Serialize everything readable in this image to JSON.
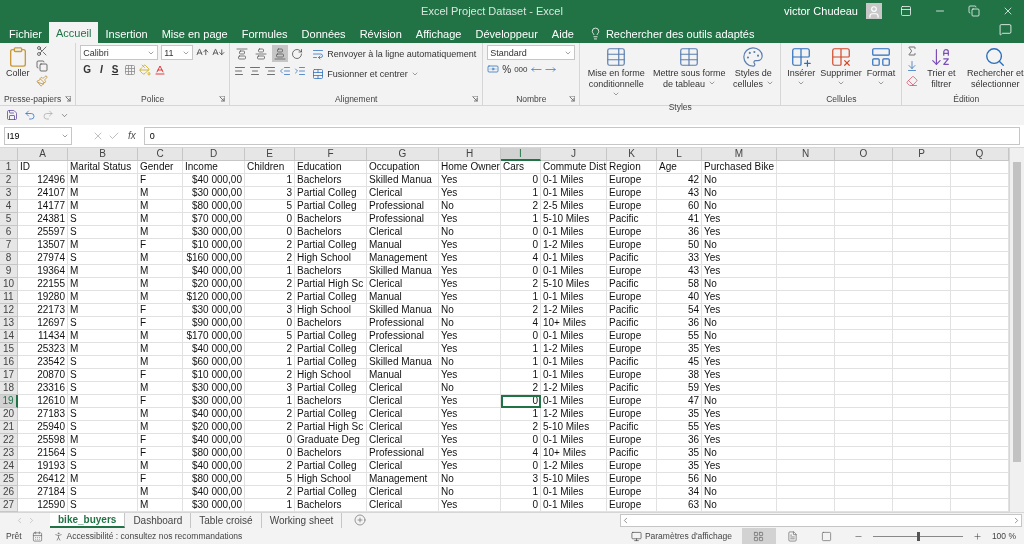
{
  "title_bar": {
    "title": "Excel Project Dataset  -  Excel",
    "user": "victor Chudeau"
  },
  "menu_tabs": [
    {
      "label": "Fichier",
      "selected": false
    },
    {
      "label": "Accueil",
      "selected": true
    },
    {
      "label": "Insertion",
      "selected": false
    },
    {
      "label": "Mise en page",
      "selected": false
    },
    {
      "label": "Formules",
      "selected": false
    },
    {
      "label": "Données",
      "selected": false
    },
    {
      "label": "Révision",
      "selected": false
    },
    {
      "label": "Affichage",
      "selected": false
    },
    {
      "label": "Développeur",
      "selected": false
    },
    {
      "label": "Aide",
      "selected": false
    }
  ],
  "tell_me": "Rechercher des outils adaptés",
  "ribbon": {
    "clipboard": {
      "label": "Presse-papiers",
      "paste": "Coller"
    },
    "font": {
      "label": "Police",
      "font_name": "Calibri",
      "font_size": "11",
      "styles": [
        "G",
        "I",
        "S"
      ]
    },
    "alignment": {
      "label": "Alignement",
      "vertical_alignment": [
        {
          "selected": false
        },
        {
          "selected": false
        },
        {
          "selected": true
        }
      ],
      "wrap": "Renvoyer à la ligne automatiquement",
      "merge": "Fusionner et centrer"
    },
    "number": {
      "label": "Nombre",
      "format": "Standard",
      "percent": "%",
      "thousands": "000"
    },
    "styles": {
      "label": "Styles",
      "buttons": [
        "Mise en forme conditionnelle",
        "Mettre sous forme de tableau",
        "Styles de cellules"
      ]
    },
    "cells": {
      "label": "Cellules",
      "buttons": [
        "Insérer",
        "Supprimer",
        "Format"
      ]
    },
    "editing": {
      "label": "Édition",
      "sort": "Trier et filtrer",
      "find": "Rechercher et sélectionner"
    }
  },
  "formula_bar": {
    "name_box": "I19",
    "fx": "fx",
    "value": "0"
  },
  "columns": [
    {
      "letter": "A",
      "kind": "number",
      "selected": false
    },
    {
      "letter": "B",
      "kind": "text",
      "selected": false
    },
    {
      "letter": "C",
      "kind": "text",
      "selected": false
    },
    {
      "letter": "D",
      "kind": "number",
      "selected": false
    },
    {
      "letter": "E",
      "kind": "number",
      "selected": false
    },
    {
      "letter": "F",
      "kind": "text",
      "selected": false
    },
    {
      "letter": "G",
      "kind": "text",
      "selected": false
    },
    {
      "letter": "H",
      "kind": "text",
      "selected": false
    },
    {
      "letter": "I",
      "kind": "number",
      "selected": true
    },
    {
      "letter": "J",
      "kind": "text",
      "selected": false
    },
    {
      "letter": "K",
      "kind": "text",
      "selected": false
    },
    {
      "letter": "L",
      "kind": "number",
      "selected": false
    },
    {
      "letter": "M",
      "kind": "text",
      "selected": false
    },
    {
      "letter": "N",
      "kind": "text",
      "selected": false
    },
    {
      "letter": "O",
      "kind": "text",
      "selected": false
    },
    {
      "letter": "P",
      "kind": "text",
      "selected": false
    },
    {
      "letter": "Q",
      "kind": "text",
      "selected": false
    }
  ],
  "header_row": {
    "number": "1",
    "cells": [
      "ID",
      "Marital Status",
      "Gender",
      "Income",
      "Children",
      "Education",
      "Occupation",
      "Home Owner",
      "Cars",
      "Commute Dist",
      "Region",
      "Age",
      "Purchased Bike"
    ]
  },
  "rows": [
    {
      "number": "2",
      "selected": false,
      "cells": [
        "12496",
        "M",
        "F",
        "$40 000,00",
        "1",
        "Bachelors",
        "Skilled Manua",
        "Yes",
        "0",
        "0-1 Miles",
        "Europe",
        "42",
        "No"
      ]
    },
    {
      "number": "3",
      "selected": false,
      "cells": [
        "24107",
        "M",
        "M",
        "$30 000,00",
        "3",
        "Partial Colleg",
        "Clerical",
        "Yes",
        "1",
        "0-1 Miles",
        "Europe",
        "43",
        "No"
      ]
    },
    {
      "number": "4",
      "selected": false,
      "cells": [
        "14177",
        "M",
        "M",
        "$80 000,00",
        "5",
        "Partial Colleg",
        "Professional",
        "No",
        "2",
        "2-5 Miles",
        "Europe",
        "60",
        "No"
      ]
    },
    {
      "number": "5",
      "selected": false,
      "cells": [
        "24381",
        "S",
        "M",
        "$70 000,00",
        "0",
        "Bachelors",
        "Professional",
        "Yes",
        "1",
        "5-10 Miles",
        "Pacific",
        "41",
        "Yes"
      ]
    },
    {
      "number": "6",
      "selected": false,
      "cells": [
        "25597",
        "S",
        "M",
        "$30 000,00",
        "0",
        "Bachelors",
        "Clerical",
        "No",
        "0",
        "0-1 Miles",
        "Europe",
        "36",
        "Yes"
      ]
    },
    {
      "number": "7",
      "selected": false,
      "cells": [
        "13507",
        "M",
        "F",
        "$10 000,00",
        "2",
        "Partial Colleg",
        "Manual",
        "Yes",
        "0",
        "1-2 Miles",
        "Europe",
        "50",
        "No"
      ]
    },
    {
      "number": "8",
      "selected": false,
      "cells": [
        "27974",
        "S",
        "M",
        "$160 000,00",
        "2",
        "High School",
        "Management",
        "Yes",
        "4",
        "0-1 Miles",
        "Pacific",
        "33",
        "Yes"
      ]
    },
    {
      "number": "9",
      "selected": false,
      "cells": [
        "19364",
        "M",
        "M",
        "$40 000,00",
        "1",
        "Bachelors",
        "Skilled Manua",
        "Yes",
        "0",
        "0-1 Miles",
        "Europe",
        "43",
        "Yes"
      ]
    },
    {
      "number": "10",
      "selected": false,
      "cells": [
        "22155",
        "M",
        "M",
        "$20 000,00",
        "2",
        "Partial High Sc",
        "Clerical",
        "Yes",
        "2",
        "5-10 Miles",
        "Pacific",
        "58",
        "No"
      ]
    },
    {
      "number": "11",
      "selected": false,
      "cells": [
        "19280",
        "M",
        "M",
        "$120 000,00",
        "2",
        "Partial Colleg",
        "Manual",
        "Yes",
        "1",
        "0-1 Miles",
        "Europe",
        "40",
        "Yes"
      ]
    },
    {
      "number": "12",
      "selected": false,
      "cells": [
        "22173",
        "M",
        "F",
        "$30 000,00",
        "3",
        "High School",
        "Skilled Manua",
        "No",
        "2",
        "1-2 Miles",
        "Pacific",
        "54",
        "Yes"
      ]
    },
    {
      "number": "13",
      "selected": false,
      "cells": [
        "12697",
        "S",
        "F",
        "$90 000,00",
        "0",
        "Bachelors",
        "Professional",
        "No",
        "4",
        "10+ Miles",
        "Pacific",
        "36",
        "No"
      ]
    },
    {
      "number": "14",
      "selected": false,
      "cells": [
        "11434",
        "M",
        "M",
        "$170 000,00",
        "5",
        "Partial Colleg",
        "Professional",
        "Yes",
        "0",
        "0-1 Miles",
        "Europe",
        "55",
        "No"
      ]
    },
    {
      "number": "15",
      "selected": false,
      "cells": [
        "25323",
        "M",
        "M",
        "$40 000,00",
        "2",
        "Partial Colleg",
        "Clerical",
        "Yes",
        "1",
        "1-2 Miles",
        "Europe",
        "35",
        "Yes"
      ]
    },
    {
      "number": "16",
      "selected": false,
      "cells": [
        "23542",
        "S",
        "M",
        "$60 000,00",
        "1",
        "Partial Colleg",
        "Skilled Manua",
        "No",
        "1",
        "0-1 Miles",
        "Pacific",
        "45",
        "Yes"
      ]
    },
    {
      "number": "17",
      "selected": false,
      "cells": [
        "20870",
        "S",
        "F",
        "$10 000,00",
        "2",
        "High School",
        "Manual",
        "Yes",
        "1",
        "0-1 Miles",
        "Europe",
        "38",
        "Yes"
      ]
    },
    {
      "number": "18",
      "selected": false,
      "cells": [
        "23316",
        "S",
        "M",
        "$30 000,00",
        "3",
        "Partial Colleg",
        "Clerical",
        "No",
        "2",
        "1-2 Miles",
        "Pacific",
        "59",
        "Yes"
      ]
    },
    {
      "number": "19",
      "selected": true,
      "cells": [
        "12610",
        "M",
        "F",
        "$30 000,00",
        "1",
        "Bachelors",
        "Clerical",
        "Yes",
        "0",
        "0-1 Miles",
        "Europe",
        "47",
        "No"
      ]
    },
    {
      "number": "20",
      "selected": false,
      "cells": [
        "27183",
        "S",
        "M",
        "$40 000,00",
        "2",
        "Partial Colleg",
        "Clerical",
        "Yes",
        "1",
        "1-2 Miles",
        "Europe",
        "35",
        "Yes"
      ]
    },
    {
      "number": "21",
      "selected": false,
      "cells": [
        "25940",
        "S",
        "M",
        "$20 000,00",
        "2",
        "Partial High Sc",
        "Clerical",
        "Yes",
        "2",
        "5-10 Miles",
        "Pacific",
        "55",
        "Yes"
      ]
    },
    {
      "number": "22",
      "selected": false,
      "cells": [
        "25598",
        "M",
        "F",
        "$40 000,00",
        "0",
        "Graduate Deg",
        "Clerical",
        "Yes",
        "0",
        "0-1 Miles",
        "Europe",
        "36",
        "Yes"
      ]
    },
    {
      "number": "23",
      "selected": false,
      "cells": [
        "21564",
        "S",
        "F",
        "$80 000,00",
        "0",
        "Bachelors",
        "Professional",
        "Yes",
        "4",
        "10+ Miles",
        "Pacific",
        "35",
        "No"
      ]
    },
    {
      "number": "24",
      "selected": false,
      "cells": [
        "19193",
        "S",
        "M",
        "$40 000,00",
        "2",
        "Partial Colleg",
        "Clerical",
        "Yes",
        "0",
        "1-2 Miles",
        "Europe",
        "35",
        "Yes"
      ]
    },
    {
      "number": "25",
      "selected": false,
      "cells": [
        "26412",
        "M",
        "F",
        "$80 000,00",
        "5",
        "High School",
        "Management",
        "No",
        "3",
        "5-10 Miles",
        "Europe",
        "56",
        "No"
      ]
    },
    {
      "number": "26",
      "selected": false,
      "cells": [
        "27184",
        "S",
        "M",
        "$40 000,00",
        "2",
        "Partial Colleg",
        "Clerical",
        "No",
        "1",
        "0-1 Miles",
        "Europe",
        "34",
        "No"
      ]
    },
    {
      "number": "27",
      "selected": false,
      "cells": [
        "12590",
        "S",
        "M",
        "$30 000,00",
        "1",
        "Bachelors",
        "Clerical",
        "Yes",
        "0",
        "0-1 Miles",
        "Europe",
        "63",
        "No"
      ]
    }
  ],
  "sheet_tabs": [
    {
      "label": "bike_buyers",
      "selected": true
    },
    {
      "label": "Dashboard",
      "selected": false
    },
    {
      "label": "Table croisé",
      "selected": false
    },
    {
      "label": "Working sheet",
      "selected": false
    }
  ],
  "status_bar": {
    "ready": "Prêt",
    "accessibility": "Accessibilité : consultez nos recommandations",
    "display_settings": "Paramètres d'affichage",
    "zoom": {
      "level": 0.5,
      "label": "100 %"
    }
  }
}
